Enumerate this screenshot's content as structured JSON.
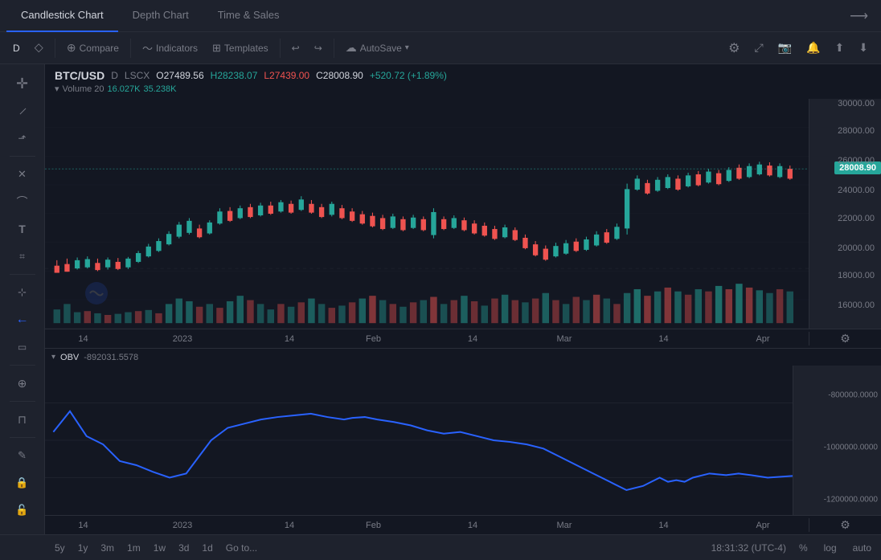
{
  "tabs": [
    {
      "id": "candlestick",
      "label": "Candlestick Chart",
      "active": true
    },
    {
      "id": "depth",
      "label": "Depth Chart",
      "active": false
    },
    {
      "id": "timesales",
      "label": "Time & Sales",
      "active": false
    }
  ],
  "toolbar": {
    "timeframe": "D",
    "compare_label": "Compare",
    "indicators_label": "Indicators",
    "templates_label": "Templates",
    "autosave_label": "AutoSave",
    "undo_icon": "↩",
    "redo_icon": "↪"
  },
  "chart": {
    "symbol": "BTC/USD",
    "timeframe": "D",
    "exchange": "LSCX",
    "open": "O27489.56",
    "high": "H28238.07",
    "low": "L27439.00",
    "close": "C28008.90",
    "change": "+520.72 (+1.89%)",
    "volume_label": "Volume 20",
    "volume_val1": "16.027K",
    "volume_val2": "35.238K",
    "current_price": "28008.90",
    "price_levels": [
      {
        "value": "30000.00",
        "pct": 2
      },
      {
        "value": "28000.00",
        "pct": 14
      },
      {
        "value": "26000.00",
        "pct": 27
      },
      {
        "value": "24000.00",
        "pct": 40
      },
      {
        "value": "22000.00",
        "pct": 52
      },
      {
        "value": "20000.00",
        "pct": 65
      },
      {
        "value": "18000.00",
        "pct": 77
      },
      {
        "value": "16000.00",
        "pct": 90
      }
    ],
    "time_labels": [
      {
        "label": "14",
        "pct": 5
      },
      {
        "label": "2023",
        "pct": 18
      },
      {
        "label": "14",
        "pct": 32
      },
      {
        "label": "Feb",
        "pct": 43
      },
      {
        "label": "14",
        "pct": 56
      },
      {
        "label": "Mar",
        "pct": 68
      },
      {
        "label": "14",
        "pct": 81
      },
      {
        "label": "Apr",
        "pct": 94
      }
    ]
  },
  "obv": {
    "label": "OBV",
    "value": "-892031.5578",
    "levels": [
      {
        "value": "-800000.0000",
        "pct": 20
      },
      {
        "value": "-1000000.0000",
        "pct": 55
      },
      {
        "value": "-1200000.0000",
        "pct": 90
      }
    ]
  },
  "bottom_bar": {
    "timeframes": [
      "5y",
      "1y",
      "3m",
      "1m",
      "1w",
      "3d",
      "1d"
    ],
    "goto": "Go to...",
    "clock": "18:31:32 (UTC-4)",
    "percent": "%",
    "log": "log",
    "auto": "auto"
  },
  "left_tools": [
    {
      "name": "crosshair",
      "icon": "✛",
      "active": false
    },
    {
      "name": "trend-line",
      "icon": "╱",
      "active": false
    },
    {
      "name": "ray-line",
      "icon": "⬏",
      "active": false
    },
    {
      "name": "eraser",
      "icon": "✕",
      "active": false
    },
    {
      "name": "polyline",
      "icon": "⌒",
      "active": false
    },
    {
      "name": "text",
      "icon": "T",
      "active": false
    },
    {
      "name": "anchored-vwap",
      "icon": "⌗",
      "active": false
    },
    {
      "name": "measure",
      "icon": "⊹",
      "active": false
    },
    {
      "name": "back-arrow",
      "icon": "←",
      "active": true
    },
    {
      "name": "ruler",
      "icon": "📏",
      "active": false
    },
    {
      "name": "zoom",
      "icon": "⊕",
      "active": false
    },
    {
      "name": "magnet",
      "icon": "⊓",
      "active": false
    },
    {
      "name": "pencil",
      "icon": "✎",
      "active": false
    },
    {
      "name": "lock",
      "icon": "🔒",
      "active": false
    },
    {
      "name": "lock2",
      "icon": "🔓",
      "active": false
    }
  ]
}
